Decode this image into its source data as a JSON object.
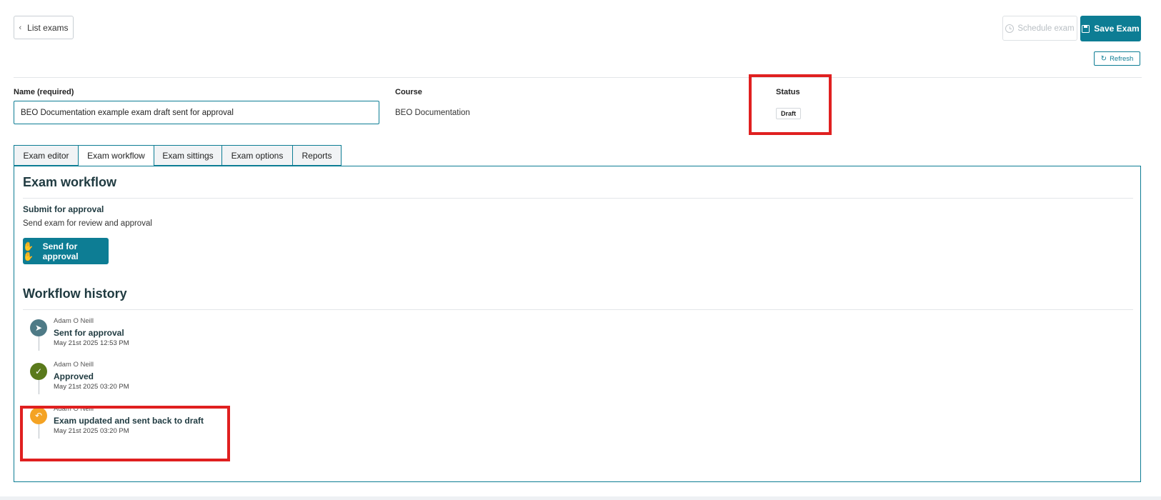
{
  "header": {
    "back_label": "List exams",
    "schedule_label": "Schedule exam",
    "save_label": "Save Exam",
    "refresh_label": "Refresh"
  },
  "fields": {
    "name_label": "Name (required)",
    "name_value": "BEO Documentation example exam draft sent for approval",
    "course_label": "Course",
    "course_value": "BEO Documentation",
    "status_label": "Status",
    "status_value": "Draft"
  },
  "tabs": [
    {
      "label": "Exam editor",
      "active": false
    },
    {
      "label": "Exam workflow",
      "active": true
    },
    {
      "label": "Exam sittings",
      "active": false
    },
    {
      "label": "Exam options",
      "active": false
    },
    {
      "label": "Reports",
      "active": false
    }
  ],
  "workflow": {
    "title": "Exam workflow",
    "submit_title": "Submit for approval",
    "submit_desc": "Send exam for review and approval",
    "send_label": "Send for approval",
    "history_title": "Workflow history",
    "history": [
      {
        "user": "Adam O Neill",
        "event": "Sent for approval",
        "date": "May 21st 2025 12:53 PM",
        "icon": "send-icon",
        "color": "#4e7a86"
      },
      {
        "user": "Adam O Neill",
        "event": "Approved",
        "date": "May 21st 2025 03:20 PM",
        "icon": "check-icon",
        "color": "#5a7a1c"
      },
      {
        "user": "Adam O Neill",
        "event": "Exam updated and sent back to draft",
        "date": "May 21st 2025 03:20 PM",
        "icon": "undo-icon",
        "color": "#f4a324"
      }
    ]
  },
  "colors": {
    "accent": "#0d7d94",
    "highlight": "#e02020"
  }
}
